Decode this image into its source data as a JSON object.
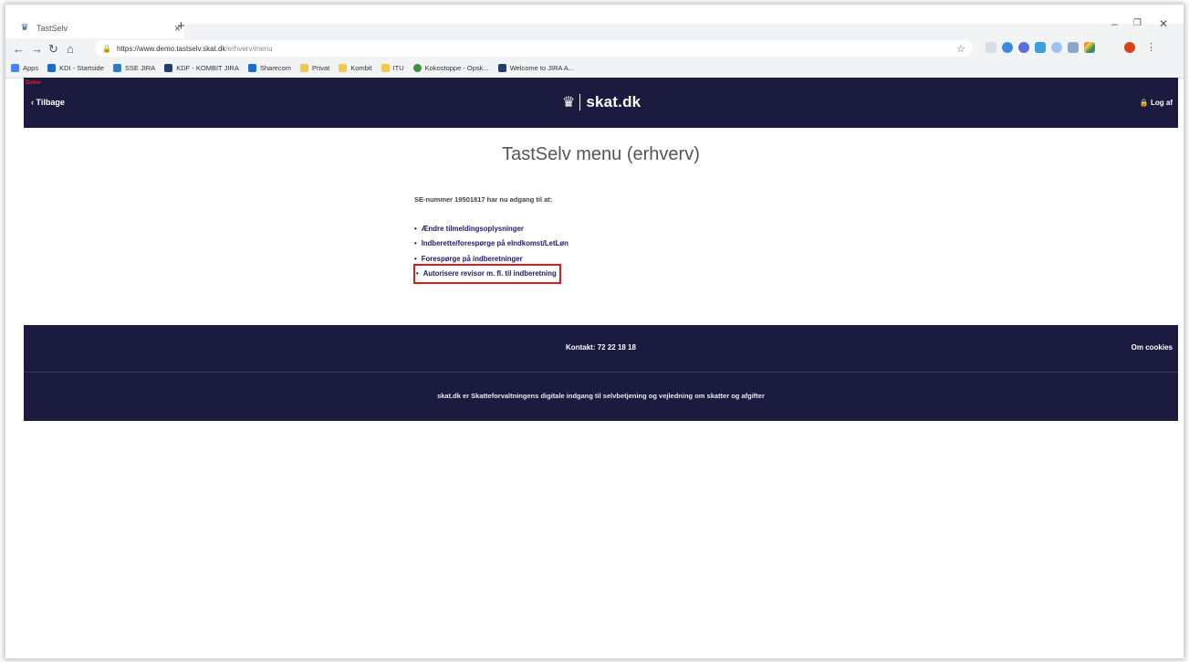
{
  "browser": {
    "tab_title": "TastSelv",
    "tab_close": "×",
    "new_tab": "+",
    "win_min": "–",
    "win_restore": "❐",
    "win_close": "✕",
    "url_host": "https://www.demo.tastselv.skat.dk",
    "url_path": "/erhverv/menu",
    "bookmarks": [
      {
        "label": "Apps",
        "color": "#4285f4"
      },
      {
        "label": "KDI - Startside",
        "color": "#1a6fc4"
      },
      {
        "label": "SSE JIRA",
        "color": "#2f7dc1"
      },
      {
        "label": "KDF - KOMBIT JIRA",
        "color": "#203d6b"
      },
      {
        "label": "Sharecom",
        "color": "#1a6fc4"
      },
      {
        "label": "Privat",
        "color": "#f2c94c"
      },
      {
        "label": "Kombit",
        "color": "#f2c94c"
      },
      {
        "label": "ITU",
        "color": "#f2c94c"
      },
      {
        "label": "Kokostoppe - Opsk...",
        "color": "#3b8e3b"
      },
      {
        "label": "Welcome to JIRA A...",
        "color": "#203d6b"
      }
    ]
  },
  "header": {
    "demo_label": "Demo",
    "back_label": "‹ Tilbage",
    "logo_text": "skat.dk",
    "logout_label": "🔒 Log af"
  },
  "main": {
    "title": "TastSelv menu (erhverv)",
    "intro": "SE-nummer 19501817 har nu adgang til at:",
    "links": [
      "Ændre tilmeldingsoplysninger",
      "Indberette/forespørge på eIndkomst/LetLøn",
      "Forespørge på indberetninger",
      "Autorisere revisor m. fl. til indberetning"
    ],
    "highlight_color": "#e01919"
  },
  "footer": {
    "contact": "Kontakt: 72 22 18 18",
    "cookies": "Om cookies",
    "tagline": "skat.dk er Skatteforvaltningens digitale indgang til selvbetjening og vejledning om skatter og afgifter"
  },
  "colors": {
    "brand_navy": "#1b1b40",
    "link": "#1b1b6a"
  }
}
